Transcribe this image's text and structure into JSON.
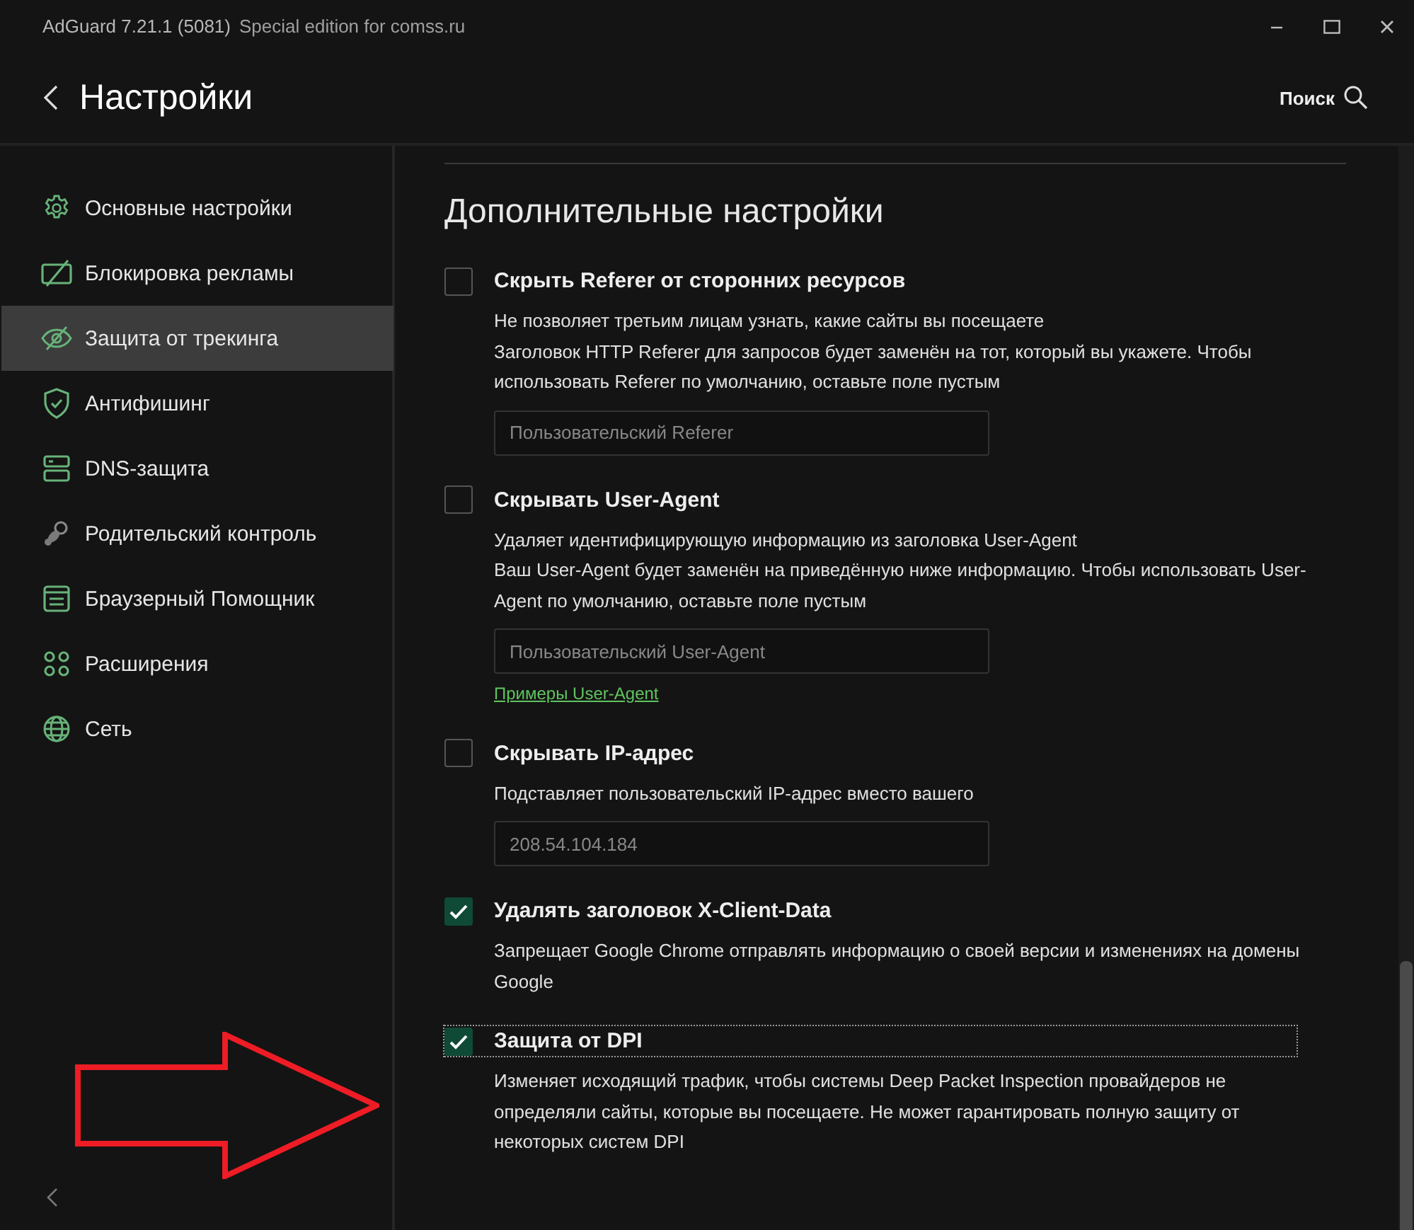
{
  "window": {
    "title": "AdGuard 7.21.1 (5081)",
    "subtitle": "Special edition for comss.ru"
  },
  "header": {
    "title": "Настройки",
    "search": "Поиск"
  },
  "sidebar": {
    "items": [
      {
        "label": "Основные настройки",
        "selected": false
      },
      {
        "label": "Блокировка рекламы",
        "selected": false
      },
      {
        "label": "Защита от трекинга",
        "selected": true
      },
      {
        "label": "Антифишинг",
        "selected": false
      },
      {
        "label": "DNS-защита",
        "selected": false
      },
      {
        "label": "Родительский контроль",
        "selected": false
      },
      {
        "label": "Браузерный Помощник",
        "selected": false
      },
      {
        "label": "Расширения",
        "selected": false
      },
      {
        "label": "Сеть",
        "selected": false
      }
    ]
  },
  "section": {
    "title": "Дополнительные настройки",
    "settings": [
      {
        "title": "Скрыть Referer от сторонних ресурсов",
        "checked": false,
        "focused": false,
        "description": [
          "Не позволяет третьим лицам узнать, какие сайты вы посещаете",
          "Заголовок HTTP Referer для запросов будет заменён на тот, который вы укажете. Чтобы использовать Referer по умолчанию, оставьте поле пустым"
        ],
        "field": {
          "placeholder": "Пользовательский Referer"
        }
      },
      {
        "title": "Скрывать User-Agent",
        "checked": false,
        "focused": false,
        "description": [
          "Удаляет идентифицирующую информацию из заголовка User-Agent",
          "Ваш User-Agent будет заменён на приведённую ниже информацию. Чтобы использовать User-Agent по умолчанию, оставьте поле пустым"
        ],
        "field": {
          "placeholder": "Пользовательский User-Agent"
        },
        "link": "Примеры User-Agent"
      },
      {
        "title": "Скрывать IP-адрес",
        "checked": false,
        "focused": false,
        "description": [
          "Подставляет пользовательский IP-адрес вместо вашего"
        ],
        "field": {
          "placeholder": "208.54.104.184"
        }
      },
      {
        "title": "Удалять заголовок X-Client-Data",
        "checked": true,
        "focused": false,
        "description": [
          "Запрещает Google Chrome отправлять информацию о своей версии и изменениях на домены Google"
        ]
      },
      {
        "title": "Защита от DPI",
        "checked": true,
        "focused": true,
        "description": [
          "Изменяет исходящий трафик, чтобы системы Deep Packet Inspection провайдеров не определяли сайты, которые вы посещаете. Не может гарантировать полную защиту от некоторых систем DPI"
        ]
      }
    ]
  }
}
